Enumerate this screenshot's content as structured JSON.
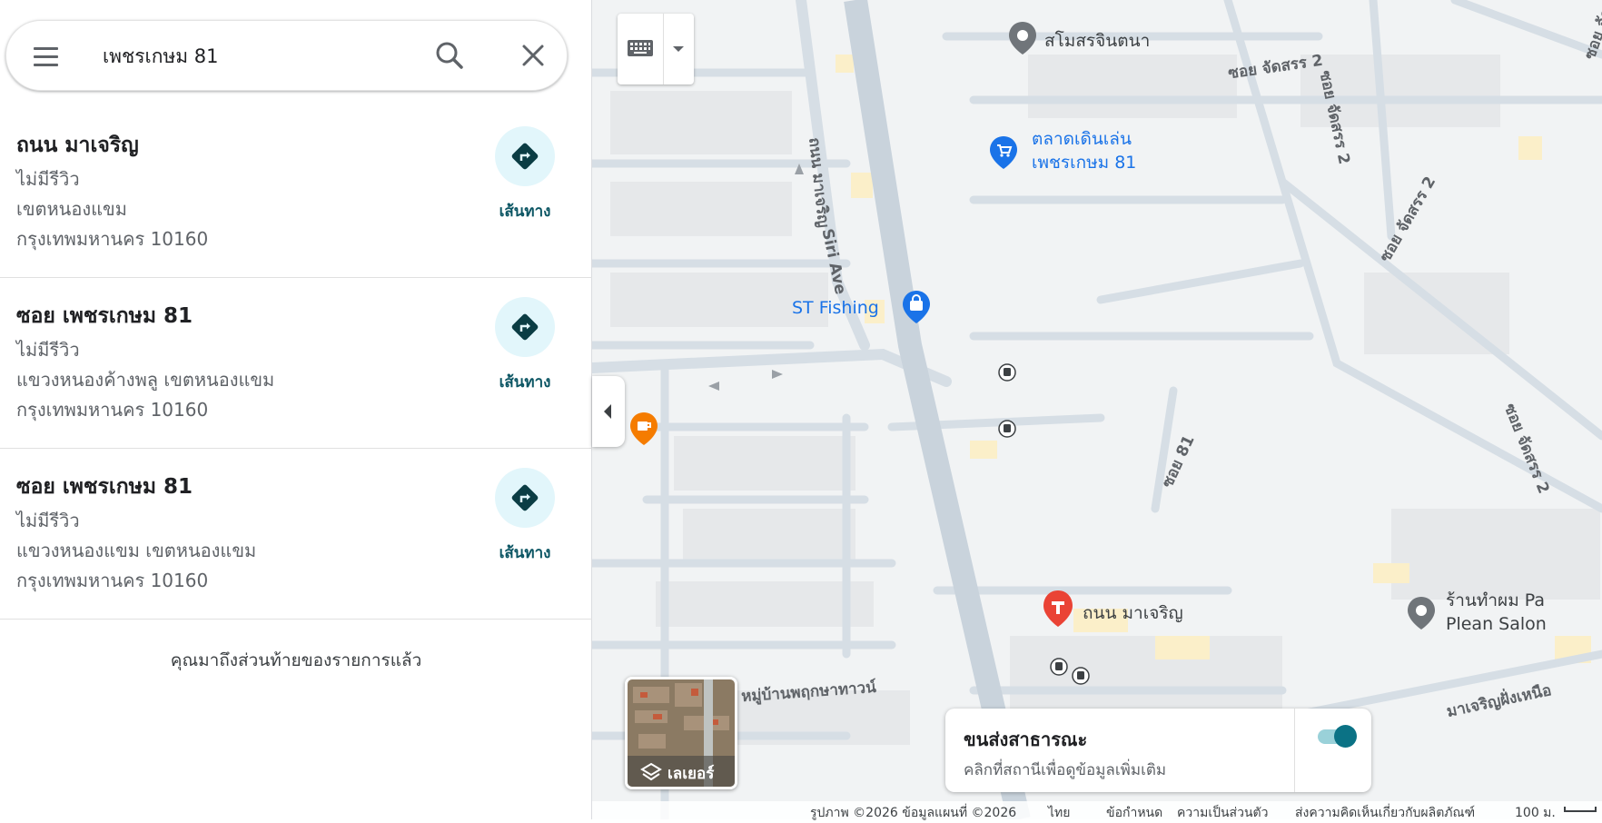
{
  "search": {
    "query": "เพชรเกษม 81"
  },
  "results": [
    {
      "name": "ถนน มาเจริญ",
      "reviews": "ไม่มีรีวิว",
      "address_line1": "เขตหนองแขม",
      "address_line2": "กรุงเทพมหานคร 10160",
      "directions_label": "เส้นทาง"
    },
    {
      "name": "ซอย เพชรเกษม 81",
      "reviews": "ไม่มีรีวิว",
      "address_line1": "แขวงหนองค้างพลู เขตหนองแขม",
      "address_line2": "กรุงเทพมหานคร 10160",
      "directions_label": "เส้นทาง"
    },
    {
      "name": "ซอย เพชรเกษม 81",
      "reviews": "ไม่มีรีวิว",
      "address_line1": "แขวงหนองแขม เขตหนองแขม",
      "address_line2": "กรุงเทพมหานคร 10160",
      "directions_label": "เส้นทาง"
    }
  ],
  "end_of_list": "คุณมาถึงส่วนท้ายของรายการแล้ว",
  "map": {
    "pois": {
      "samosorn": "สโมสรจินตนา",
      "market_line1": "ตลาดเดินเล่น",
      "market_line2": "เพชรเกษม 81",
      "st_fishing": "ST Fishing",
      "selected_place": "ถนน มาเจริญ",
      "salon_line1": "ร้านทำผม Pa",
      "salon_line2": "Plean Salon"
    },
    "streets": {
      "main_road": "ถนน มาเจริญ",
      "siri_ave": "Siri Ave",
      "soi_jatsorn_top": "ซอย จัดสรร 2",
      "soi_jatsorn_vertical": "ซอย จัดสรร 2",
      "soi_jatsorn_diag": "ซอย จัดสรร 2",
      "soi_jatsorn_right": "ซอย จัดสรร 2",
      "soi_81": "ซอย 81",
      "village": "หมู่บ้านพฤกษาทาวน์",
      "north_road": "มาเจริญฝั่งเหนือ"
    },
    "layers_label": "เลเยอร์",
    "transit": {
      "title": "ขนส่งสาธารณะ",
      "subtitle": "คลิกที่สถานีเพื่อดูข้อมูลเพิ่มเติม",
      "enabled": true
    },
    "footer": {
      "attribution": "รูปภาพ ©2026 ข้อมูลแผนที่ ©2026",
      "language": "ไทย",
      "terms": "ข้อกำหนด",
      "privacy": "ความเป็นส่วนตัว",
      "feedback": "ส่งความคิดเห็นเกี่ยวกับผลิตภัณฑ์",
      "scale": "100 ม."
    }
  },
  "colors": {
    "accent_teal": "#0b7285",
    "directions_bg": "#e2f6fb",
    "poi_blue": "#1a73e8",
    "pin_red": "#ea4335",
    "cafe_orange": "#f57c00",
    "road": "#d6dee5",
    "map_bg": "#f1f3f4"
  }
}
